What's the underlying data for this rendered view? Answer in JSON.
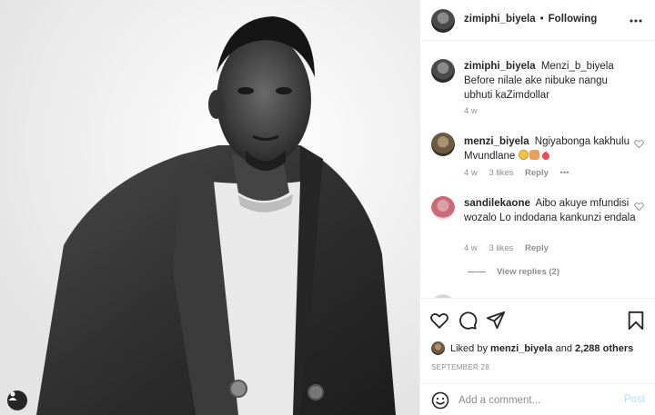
{
  "header": {
    "username": "zimiphi_biyela",
    "separator": "•",
    "follow_status": "Following",
    "more_icon": "more-horizontal-icon"
  },
  "caption": {
    "username": "zimiphi_biyela",
    "text": "Menzi_b_biyela Before nilale ake nibuke nangu ubhuti kaZimdollar",
    "time": "4 w"
  },
  "comments": [
    {
      "username": "menzi_biyela",
      "text": "Ngiyabonga kakhulu Mvundlane",
      "emojis": [
        "smiling-face-icon",
        "praying-hands-icon",
        "red-heart-icon"
      ],
      "time": "4 w",
      "likes": "3 likes",
      "reply": "Reply",
      "more": "•••"
    },
    {
      "username": "sandilekaone",
      "text": "Aibo akuye mfundisi wozalo Lo indodana kankunzi endala",
      "time": "4 w",
      "likes": "3 likes",
      "reply": "Reply",
      "view_replies": "View replies (2)"
    }
  ],
  "actions": {
    "liked_prefix": "Liked by",
    "liked_user": "menzi_biyela",
    "liked_and": "and",
    "liked_others": "2,288 others",
    "date": "SEPTEMBER 28"
  },
  "composer": {
    "placeholder": "Add a comment...",
    "post_label": "Post"
  },
  "colors": {
    "link_blue_disabled": "#b2dffc",
    "muted_gray": "#8e8e8e",
    "text": "#262626",
    "heart_red": "#ed4956"
  }
}
